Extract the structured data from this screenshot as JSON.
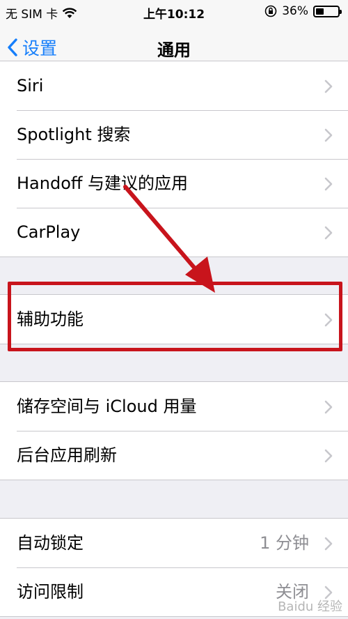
{
  "status_bar": {
    "carrier": "无 SIM 卡",
    "time": "上午10:12",
    "battery_percent": "36%",
    "battery_level": 0.36
  },
  "nav": {
    "back_label": "设置",
    "title": "通用"
  },
  "groups": [
    {
      "rows": [
        {
          "label": "Siri"
        },
        {
          "label": "Spotlight 搜索"
        },
        {
          "label": "Handoff 与建议的应用"
        },
        {
          "label": "CarPlay"
        }
      ]
    },
    {
      "rows": [
        {
          "label": "辅助功能"
        }
      ]
    },
    {
      "rows": [
        {
          "label": "储存空间与 iCloud 用量"
        },
        {
          "label": "后台应用刷新"
        }
      ]
    },
    {
      "rows": [
        {
          "label": "自动锁定",
          "value": "1 分钟"
        },
        {
          "label": "访问限制",
          "value": "关闭"
        }
      ]
    }
  ],
  "watermark": "Baidu 经验",
  "colors": {
    "accent": "#157efb",
    "annotation": "#c8141c"
  }
}
